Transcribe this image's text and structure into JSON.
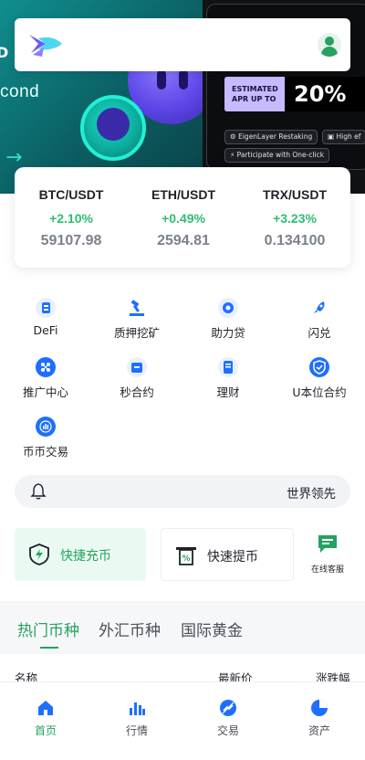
{
  "banner": {
    "left_text": "cond",
    "left_partial": "D",
    "apr_label": "ESTIMATED\nAPR UP TO",
    "apr_value": "20%",
    "chips": [
      "EigenLayer Restaking",
      "High ef",
      "Participate with One-click"
    ]
  },
  "tickers": [
    {
      "pair": "BTC/USDT",
      "change": "+2.10%",
      "price": "59107.98"
    },
    {
      "pair": "ETH/USDT",
      "change": "+0.49%",
      "price": "2594.81"
    },
    {
      "pair": "TRX/USDT",
      "change": "+3.23%",
      "price": "0.134100"
    }
  ],
  "grid": [
    {
      "label": "DeFi",
      "icon": "defi-icon"
    },
    {
      "label": "质押挖矿",
      "icon": "staking-icon"
    },
    {
      "label": "助力贷",
      "icon": "loan-icon"
    },
    {
      "label": "闪兑",
      "icon": "rocket-icon"
    },
    {
      "label": "推广中心",
      "icon": "referral-icon"
    },
    {
      "label": "秒合约",
      "icon": "seconds-contract-icon"
    },
    {
      "label": "理财",
      "icon": "finance-icon"
    },
    {
      "label": "U本位合约",
      "icon": "shield-icon"
    },
    {
      "label": "币币交易",
      "icon": "spot-trade-icon"
    }
  ],
  "notice": {
    "text": "世界领先"
  },
  "quick_actions": {
    "deposit": "快捷充币",
    "withdraw": "快速提币",
    "support": "在线客服"
  },
  "market": {
    "tabs": [
      "热门币种",
      "外汇币种",
      "国际黄金"
    ],
    "active_tab": 0,
    "columns": [
      "名称",
      "最新价",
      "涨跌幅"
    ]
  },
  "nav": [
    {
      "label": "首页",
      "icon": "home-icon",
      "active": true
    },
    {
      "label": "行情",
      "icon": "chart-icon",
      "active": false
    },
    {
      "label": "交易",
      "icon": "trade-icon",
      "active": false
    },
    {
      "label": "资产",
      "icon": "pie-icon",
      "active": false
    }
  ],
  "colors": {
    "accent": "#27a160",
    "up": "#2ebd74",
    "icon_blue": "#1e6fff"
  }
}
